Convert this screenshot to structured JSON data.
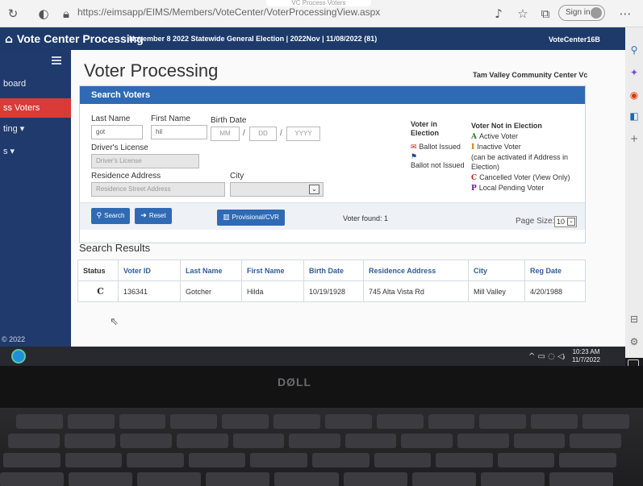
{
  "browser": {
    "tab_hint": "VC Process Voters",
    "url": "https://eimsapp/EIMS/Members/VoteCenter/VoterProcessingView.aspx",
    "signin": "Sign in"
  },
  "appbar": {
    "title": "Vote Center Processing",
    "election": "November 8 2022 Statewide General Election | 2022Nov | 11/08/2022 (81)",
    "vote_center": "VoteCenter16B"
  },
  "sidebar": {
    "items": [
      {
        "label": "board"
      },
      {
        "label": "ss Voters"
      },
      {
        "label": "ting ▾"
      },
      {
        "label": "s ▾"
      }
    ],
    "footer": "2022"
  },
  "page": {
    "title": "Voter Processing",
    "center_name": "Tam Valley Community Center Vc"
  },
  "search": {
    "header": "Search Voters",
    "last_name_label": "Last Name",
    "last_name_value": "got",
    "first_name_label": "First Name",
    "first_name_value": "hil",
    "birth_date_label": "Birth Date",
    "mm_placeholder": "MM",
    "dd_placeholder": "DD",
    "yyyy_placeholder": "YYYY",
    "date_sep": "/",
    "license_label": "Driver's License",
    "license_placeholder": "Driver's License",
    "address_label": "Residence Address",
    "address_placeholder": "Residence Street Address",
    "city_label": "City",
    "city_value": ""
  },
  "legend": {
    "in_election_title": "Voter in Election",
    "ballot_issued": "Ballot Issued",
    "ballot_not_issued": "Ballot not Issued",
    "not_in_election_title": "Voter Not in Election",
    "active": {
      "code": "A",
      "text": "Active Voter"
    },
    "inactive": {
      "code": "I",
      "text": "Inactive Voter"
    },
    "inactive_note_1": "(can be activated if Address in",
    "inactive_note_2": "Election)",
    "cancelled": {
      "code": "C",
      "text": "Cancelled Voter (View Only)"
    },
    "pending": {
      "code": "P",
      "text": "Local Pending Voter"
    }
  },
  "actions": {
    "search": "Search",
    "reset": "Reset",
    "provisional": "Provisional/CVR",
    "voter_found": "Voter found: 1",
    "page_size_label": "Page Size:",
    "page_size_value": "10"
  },
  "results": {
    "title": "Search Results",
    "columns": [
      "Status",
      "Voter ID",
      "Last Name",
      "First Name",
      "Birth Date",
      "Residence Address",
      "City",
      "Reg Date"
    ],
    "rows": [
      {
        "status": "C",
        "voter_id": "136341",
        "last_name": "Gotcher",
        "first_name": "Hilda",
        "birth_date": "10/19/1928",
        "address": "745 Alta Vista Rd",
        "city": "Mill Valley",
        "reg_date": "4/20/1988"
      }
    ]
  },
  "taskbar": {
    "time": "10:23 AM",
    "date": "11/7/2022"
  },
  "laptop": {
    "brand": "DØLL"
  },
  "colors": {
    "appbar": "#1d3a6b",
    "sidebar": "#203a6e",
    "active_nav": "#d93b37",
    "accent": "#2f6ab5",
    "status_cancelled": "#c0261d"
  }
}
